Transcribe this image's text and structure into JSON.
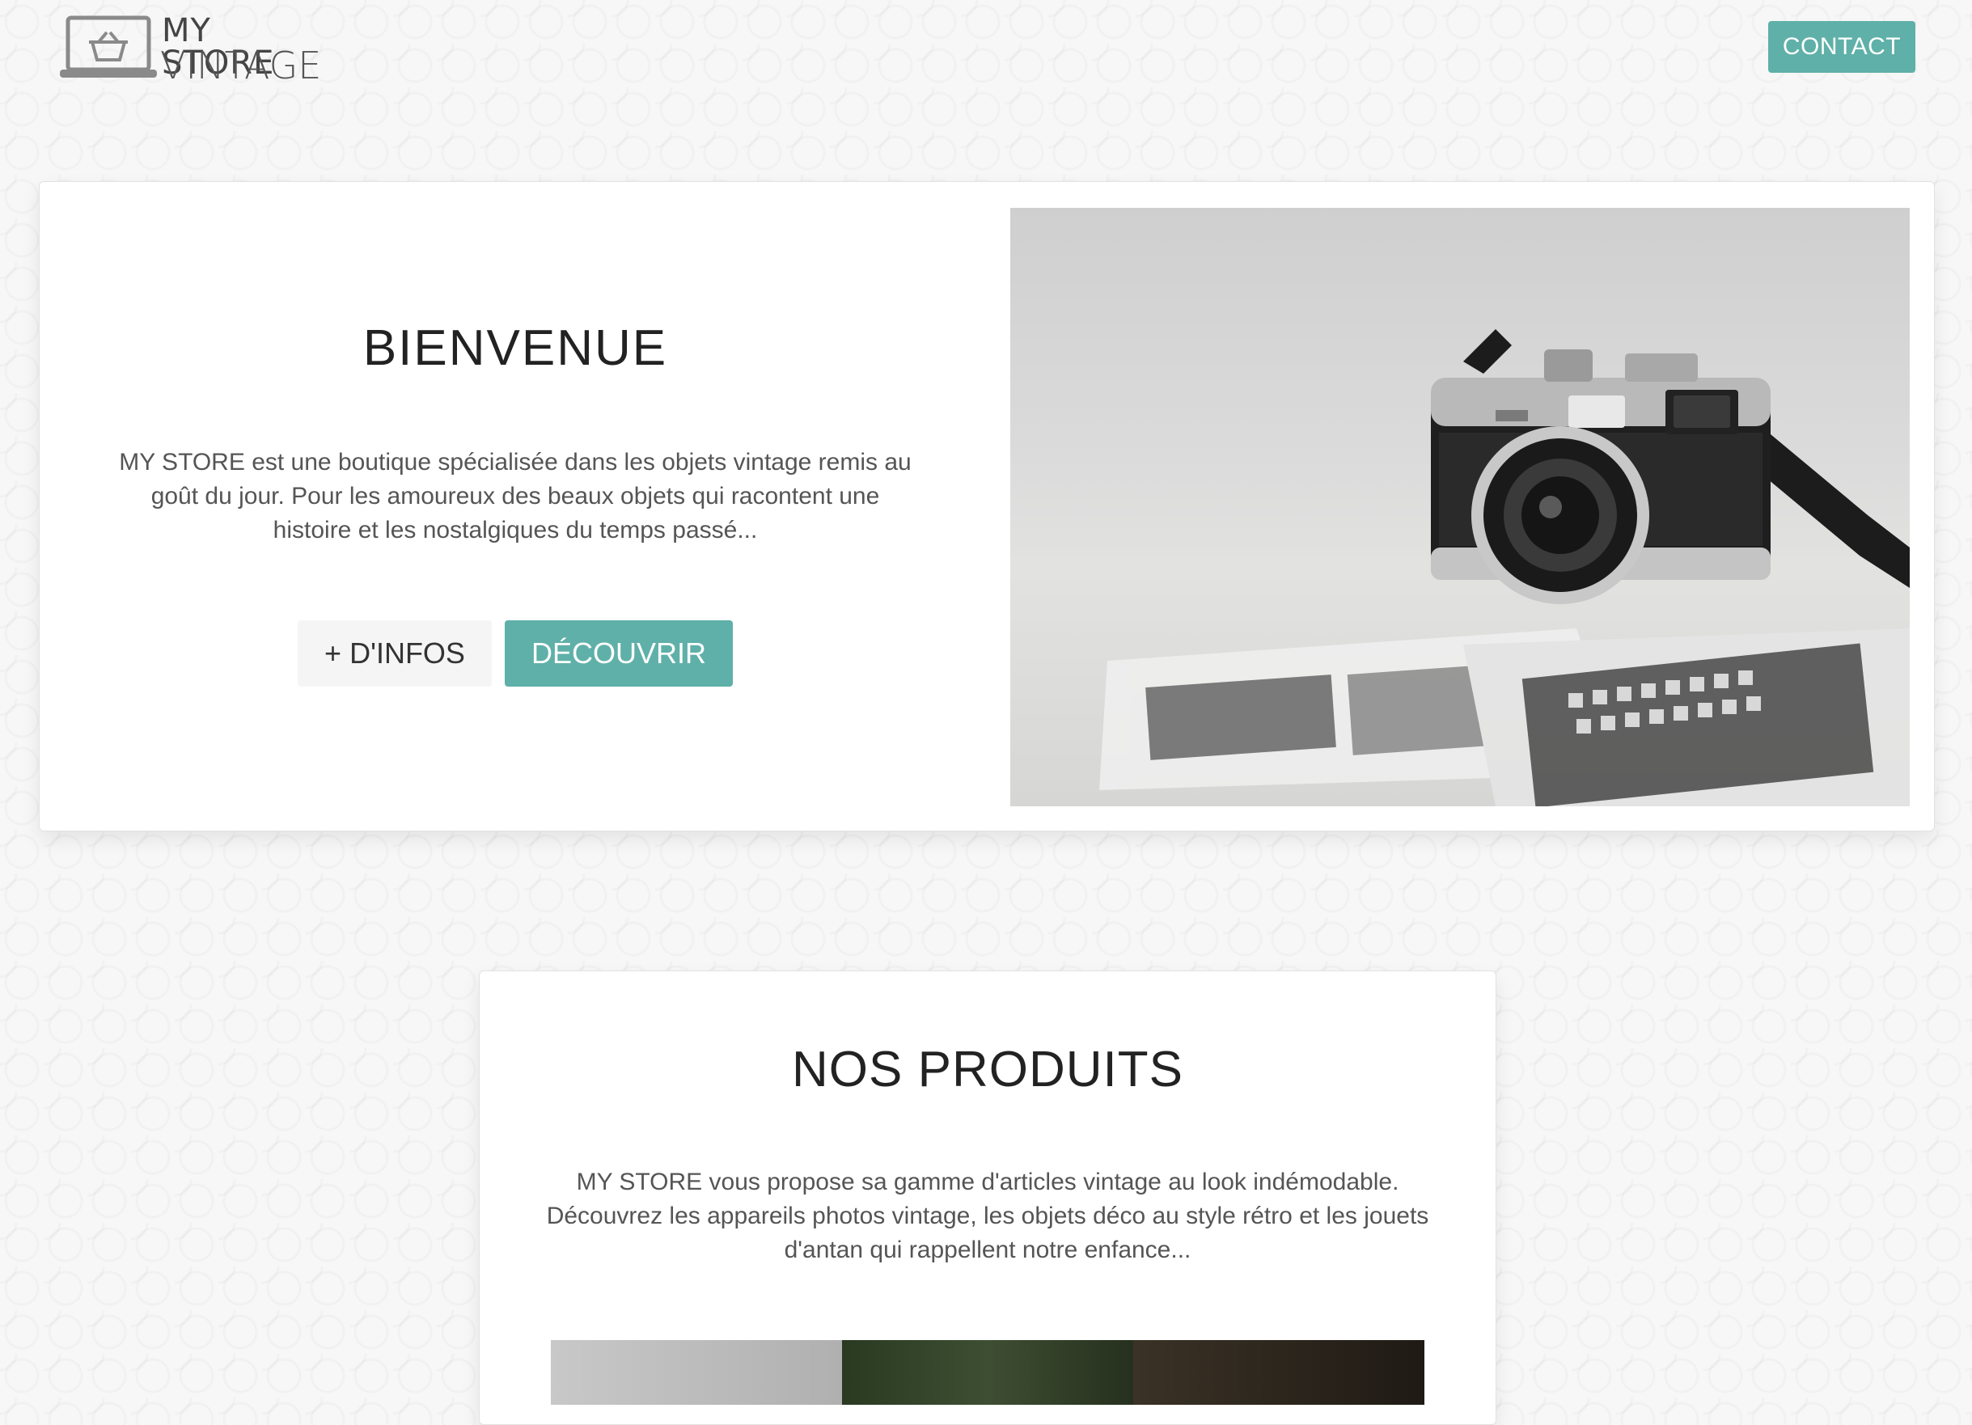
{
  "header": {
    "logo_line1": "MY STORE",
    "logo_line2": "VINTAGE",
    "contact_label": "CONTACT"
  },
  "hero": {
    "title": "BIENVENUE",
    "description": "MY STORE est une boutique spécialisée dans les objets vintage remis au goût du jour. Pour les amoureux des beaux objets qui racontent une histoire et les nostalgiques du temps passé...",
    "info_button": "+ D'INFOS",
    "discover_button": "DÉCOUVRIR",
    "image_icon": "vintage-camera-photo"
  },
  "products": {
    "title": "NOS PRODUITS",
    "description": "MY STORE vous propose sa gamme d'articles vintage au look indémodable. Découvrez les appareils photos vintage, les objets déco au style rétro et les jouets d'antan qui rappellent notre enfance..."
  },
  "colors": {
    "accent": "#5fb0a8",
    "text_dark": "#222222",
    "text_muted": "#555555"
  }
}
